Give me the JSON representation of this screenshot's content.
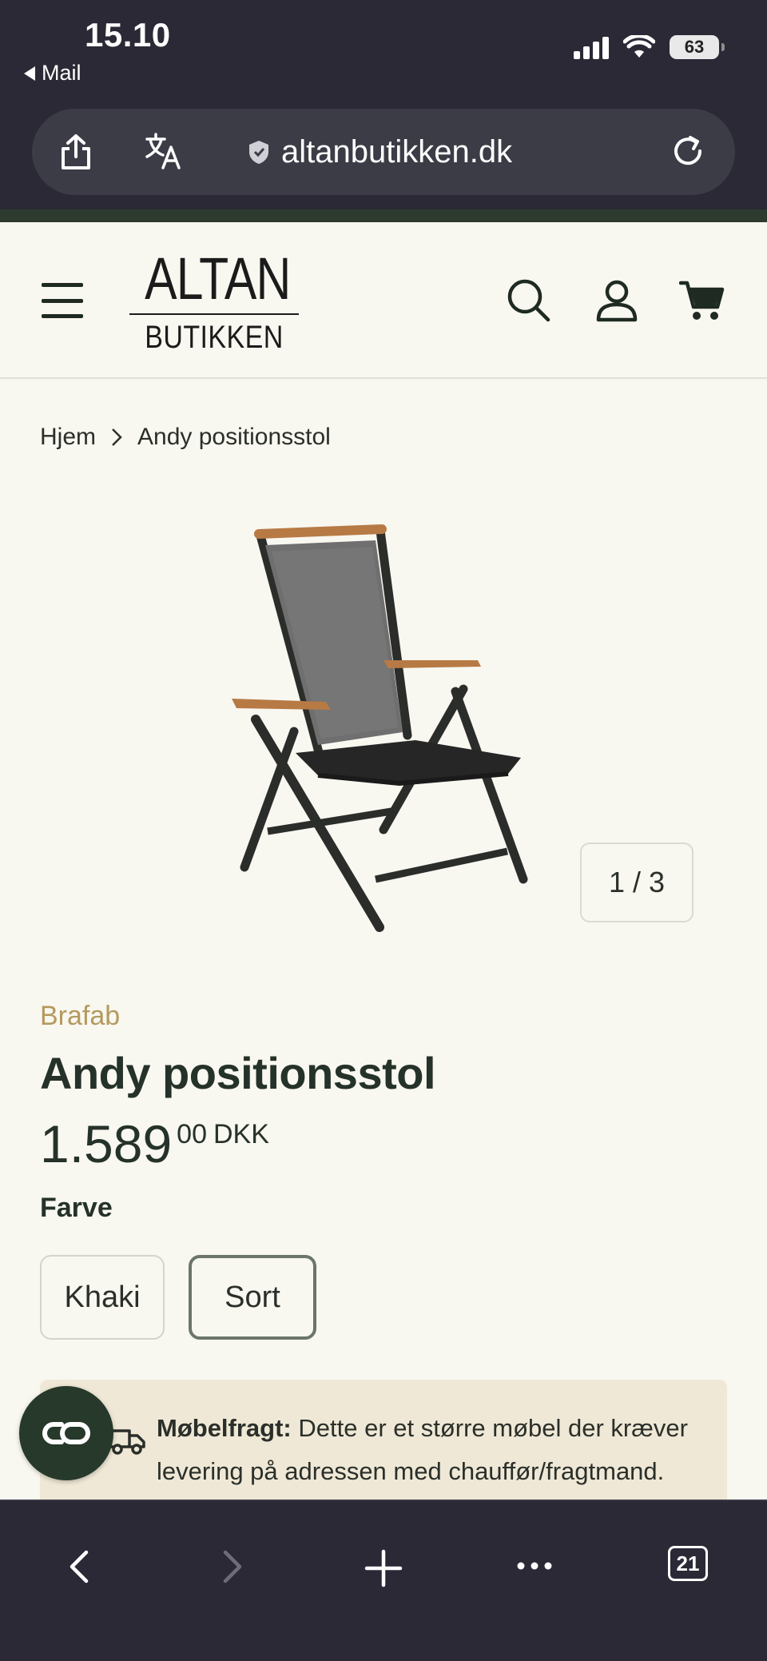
{
  "status_bar": {
    "time": "15.10",
    "back_app": "Mail",
    "battery": "63"
  },
  "browser": {
    "url": "altanbutikken.dk",
    "tab_count": "21"
  },
  "site": {
    "logo_top": "ALTAN",
    "logo_bottom": "BUTIKKEN"
  },
  "breadcrumb": {
    "home": "Hjem",
    "current": "Andy positionsstol"
  },
  "product": {
    "image_counter": "1 / 3",
    "brand": "Brafab",
    "title": "Andy positionsstol",
    "price_int": "1.589",
    "price_dec": "00",
    "currency": "DKK",
    "option_label": "Farve",
    "options": [
      "Khaki",
      "Sort"
    ],
    "selected_option": "Sort"
  },
  "notice": {
    "bold": "Møbelfragt:",
    "text": " Dette er et større møbel der kræver levering på adressen med chauffør/fragtmand."
  },
  "colors": {
    "dark_green": "#26392b",
    "brand_gold": "#b49a5e",
    "page_bg": "#f8f7f0",
    "chrome_bg": "#2a2935"
  }
}
